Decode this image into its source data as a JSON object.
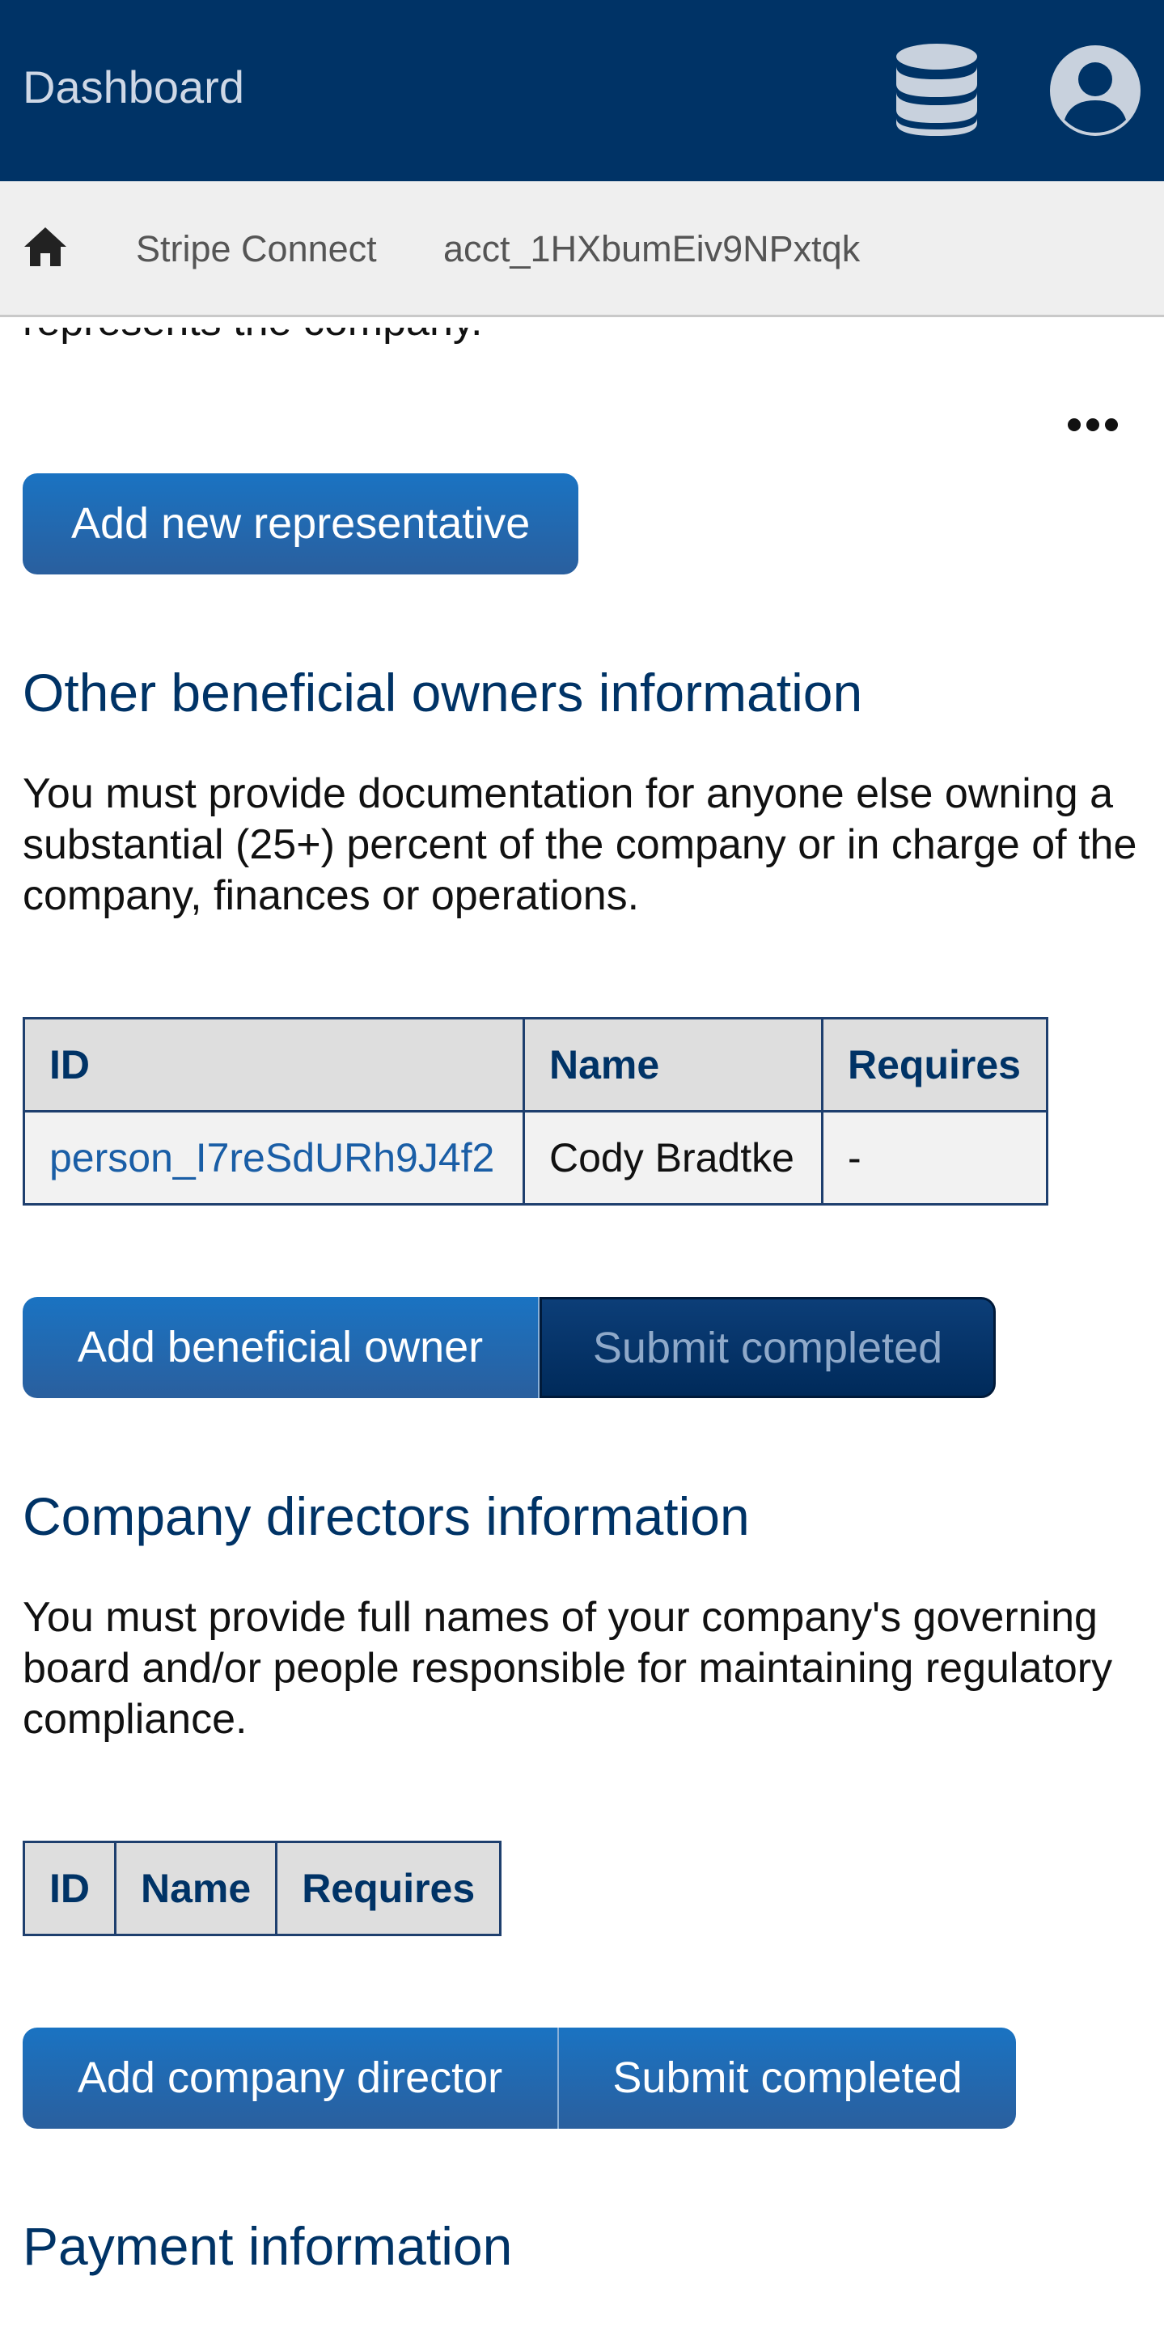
{
  "header": {
    "title": "Dashboard",
    "icons": [
      "database-icon",
      "user-icon"
    ],
    "background_color": "#003366"
  },
  "breadcrumb": {
    "items": [
      "Stripe Connect",
      "acct_1HXbumEiv9NPxtqk"
    ],
    "icons": [
      "home-icon",
      "more-icon"
    ]
  },
  "main": {
    "clipped_text": "represents the company.",
    "add_representative_label": "Add new representative",
    "beneficial": {
      "title": "Other beneficial owners information",
      "description": "You must provide documentation for anyone else owning a substantial (25+) percent of the company or in charge of the company, finances or operations.",
      "columns": [
        "ID",
        "Name",
        "Requires"
      ],
      "rows": [
        {
          "id": "person_I7reSdURh9J4f2",
          "name": "Cody Bradtke",
          "requires": "-"
        }
      ],
      "add_label": "Add beneficial owner",
      "submit_label": "Submit completed"
    },
    "directors": {
      "title": "Company directors information",
      "description": "You must provide full names of your company's governing board and/or people responsible for maintaining regulatory compliance.",
      "columns": [
        "ID",
        "Name",
        "Requires"
      ],
      "add_label": "Add company director",
      "submit_label": "Submit completed"
    },
    "payment": {
      "title": "Payment information"
    }
  },
  "colors": {
    "accent": "#1a73c2",
    "heading": "#003366",
    "link": "#1a5ea6"
  }
}
